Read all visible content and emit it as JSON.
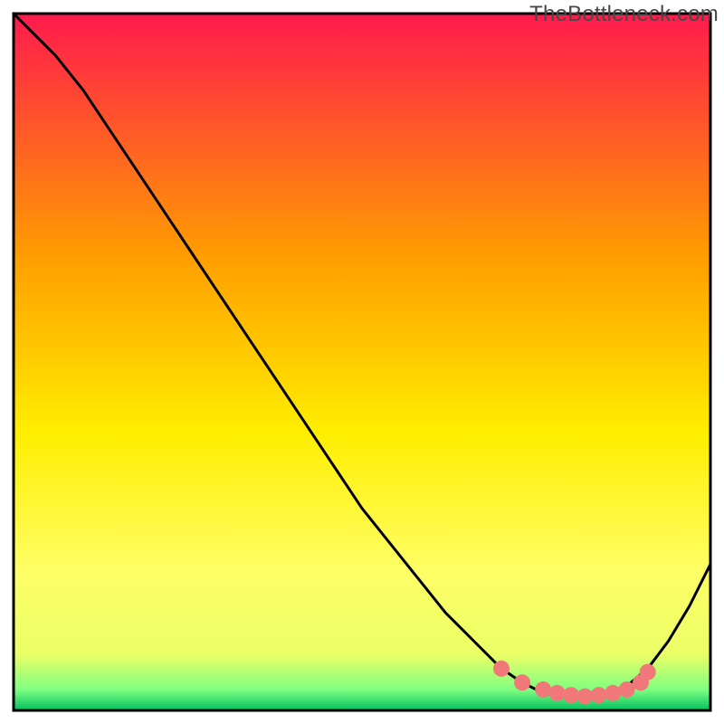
{
  "watermark": "TheBottleneck.com",
  "colors": {
    "curve": "#000000",
    "border": "#000000",
    "dot": "#f07878",
    "gradient_top": "#ff1a4d",
    "gradient_mid1": "#ffb000",
    "gradient_mid2": "#ffee00",
    "gradient_mid3": "#ffff80",
    "gradient_bottom": "#00c060"
  },
  "chart_data": {
    "type": "line",
    "title": "",
    "xlabel": "",
    "ylabel": "",
    "xlim": [
      0,
      100
    ],
    "ylim": [
      0,
      100
    ],
    "grid": false,
    "legend": false,
    "x": [
      0,
      3,
      6,
      10,
      14,
      18,
      22,
      26,
      30,
      34,
      38,
      42,
      46,
      50,
      54,
      58,
      62,
      66,
      70,
      73,
      76,
      79,
      82,
      85,
      88,
      91,
      94,
      97,
      100
    ],
    "values": [
      100,
      97,
      94,
      89,
      83,
      77,
      71,
      65,
      59,
      53,
      47,
      41,
      35,
      29,
      24,
      19,
      14,
      10,
      6,
      4,
      2.5,
      2,
      2,
      2.5,
      3.5,
      6,
      10,
      15,
      21
    ],
    "dots_x": [
      70,
      73,
      76,
      78,
      80,
      82,
      84,
      86,
      88,
      90,
      91
    ],
    "dots_y": [
      6,
      4,
      3,
      2.5,
      2.2,
      2,
      2.2,
      2.5,
      3,
      4,
      5.5
    ]
  }
}
